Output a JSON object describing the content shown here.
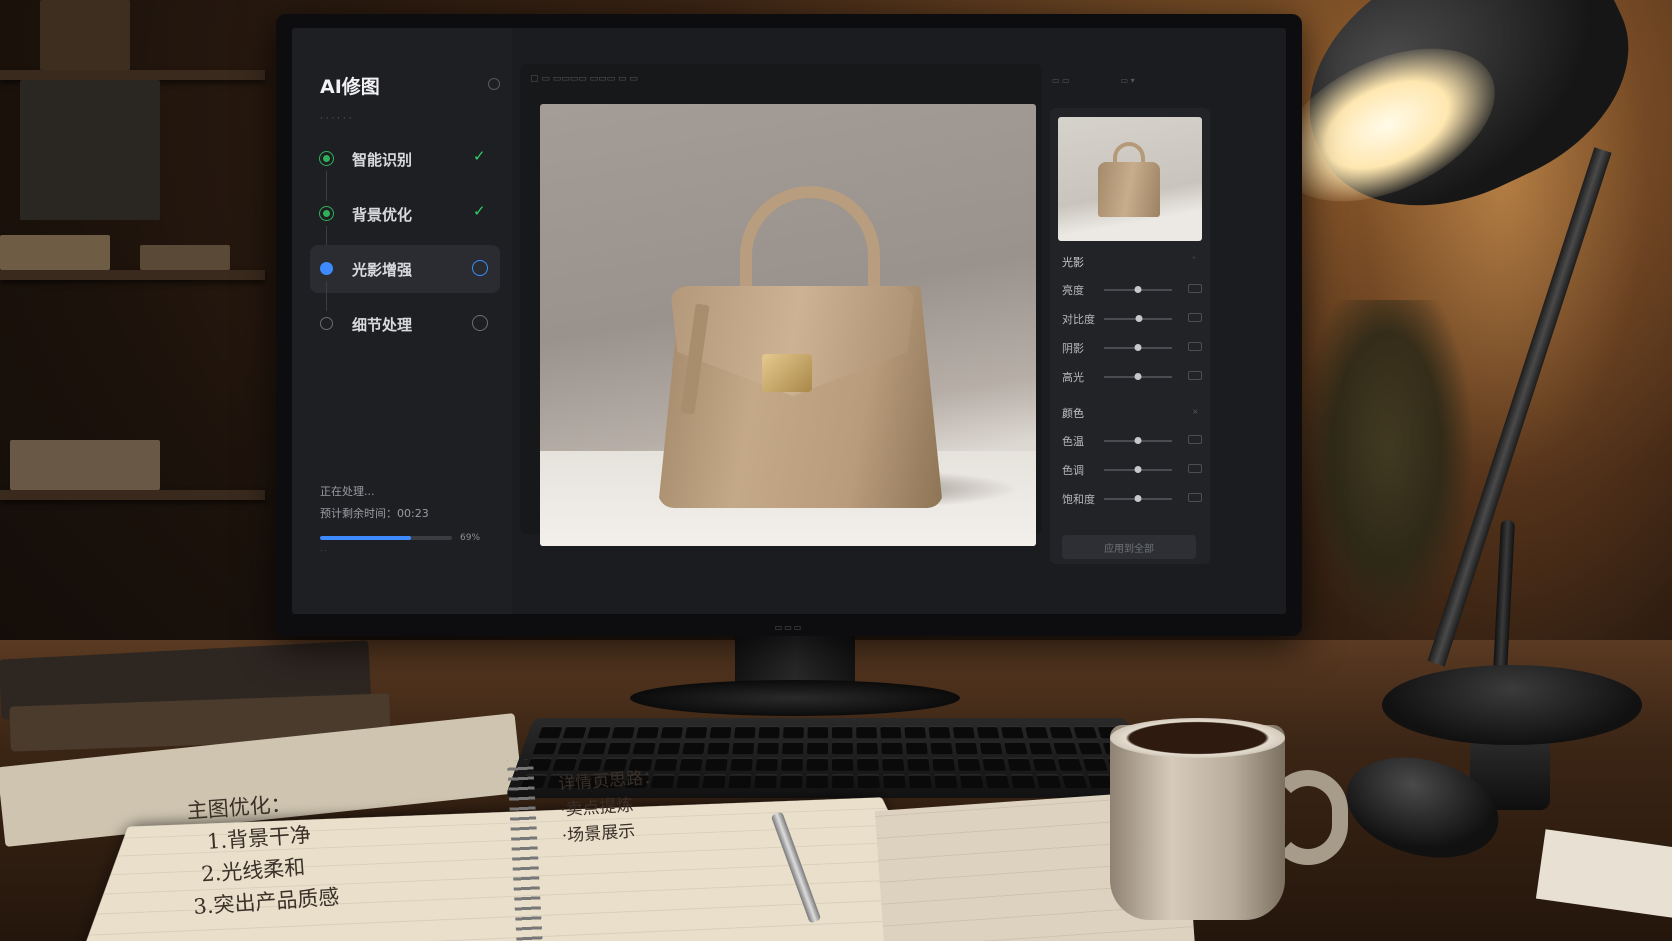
{
  "app": {
    "title": "AI修图"
  },
  "steps": [
    {
      "label": "智能识别",
      "status": "done"
    },
    {
      "label": "背景优化",
      "status": "done"
    },
    {
      "label": "光影增强",
      "status": "active"
    },
    {
      "label": "细节处理",
      "status": "pending"
    }
  ],
  "progress": {
    "status_text": "正在处理...",
    "eta_label": "预计剩余时间：",
    "eta_value": "00:23",
    "percent_label": "69%",
    "fraction": 0.69
  },
  "panel": {
    "lighting_group": "光影",
    "lighting_sliders": [
      {
        "name": "亮度",
        "value": 0.5
      },
      {
        "name": "对比度",
        "value": 0.52
      },
      {
        "name": "阴影",
        "value": 0.5
      },
      {
        "name": "高光",
        "value": 0.5
      }
    ],
    "color_group": "颜色",
    "color_sliders": [
      {
        "name": "色温",
        "value": 0.5
      },
      {
        "name": "色调",
        "value": 0.5
      },
      {
        "name": "饱和度",
        "value": 0.5
      }
    ],
    "apply_label": "应用到全部"
  },
  "notes": {
    "left_lines": [
      "主图优化：",
      "1.背景干净",
      "2.光线柔和",
      "3.突出产品质感"
    ],
    "right_lines": [
      "详情页思路：",
      "·卖点提炼",
      "·场景展示"
    ]
  },
  "colors": {
    "accent": "#3d8bff",
    "done": "#2fb05a"
  }
}
